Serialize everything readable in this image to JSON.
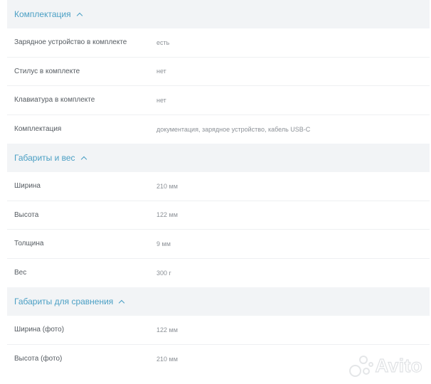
{
  "sections": [
    {
      "title": "Комплектация",
      "rows": [
        {
          "label": "Зарядное устройство в комплекте",
          "value": "есть"
        },
        {
          "label": "Стилус в комплекте",
          "value": "нет"
        },
        {
          "label": "Клавиатура в комплекте",
          "value": "нет"
        },
        {
          "label": "Комплектация",
          "value": "документация, зарядное устройство, кабель USB-C"
        }
      ]
    },
    {
      "title": "Габариты и вес",
      "rows": [
        {
          "label": "Ширина",
          "value": "210 мм"
        },
        {
          "label": "Высота",
          "value": "122 мм"
        },
        {
          "label": "Толщина",
          "value": "9 мм"
        },
        {
          "label": "Вес",
          "value": "300 г"
        }
      ]
    },
    {
      "title": "Габариты для сравнения",
      "rows": [
        {
          "label": "Ширина (фото)",
          "value": "122 мм"
        },
        {
          "label": "Высота (фото)",
          "value": "210 мм"
        }
      ]
    }
  ],
  "watermark": {
    "text": "Avito",
    "icon": "avito-logo-icon"
  },
  "colors": {
    "accent": "#4a9fc4",
    "header_bg": "#f2f4f6",
    "label": "#555b61",
    "value": "#8c9197"
  }
}
